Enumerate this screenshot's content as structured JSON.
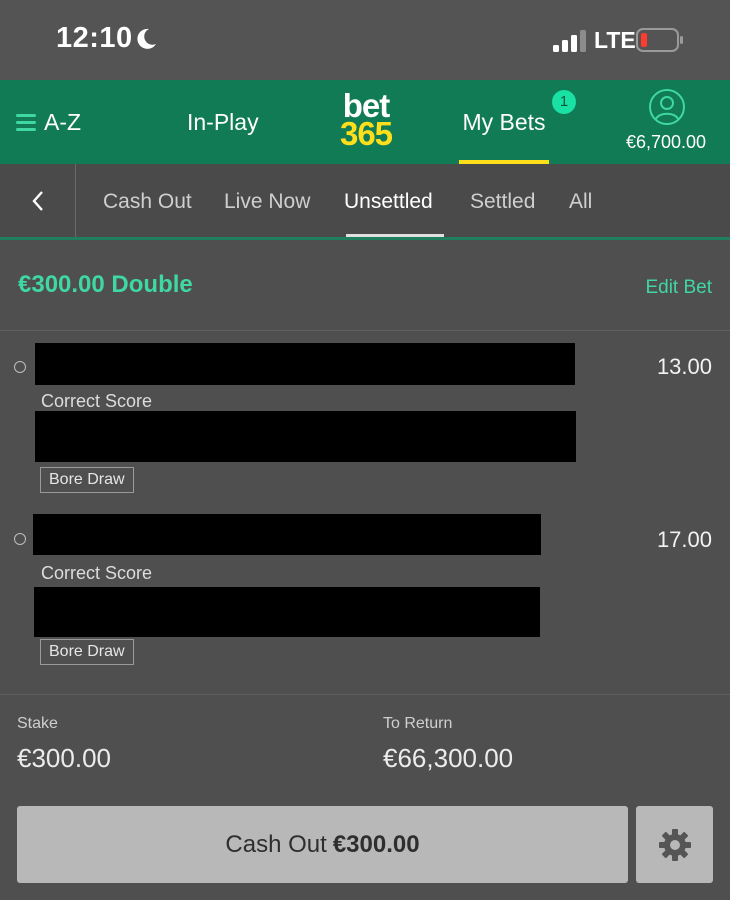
{
  "status_bar": {
    "time": "12:10",
    "network": "LTE"
  },
  "header": {
    "az_label": "A-Z",
    "inplay_label": "In-Play",
    "logo_top": "bet",
    "logo_bottom": "365",
    "mybets_label": "My Bets",
    "mybets_badge": "1",
    "balance": "€6,700.00",
    "brand_green": "#117b56",
    "brand_yellow": "#ffdf1b"
  },
  "tabs": {
    "items": [
      {
        "label": "Cash Out"
      },
      {
        "label": "Live Now"
      },
      {
        "label": "Unsettled"
      },
      {
        "label": "Settled"
      },
      {
        "label": "All"
      }
    ],
    "active": "Unsettled"
  },
  "bet": {
    "title": "€300.00 Double",
    "edit_label": "Edit Bet",
    "selections": [
      {
        "market": "Correct Score",
        "tag": "Bore Draw",
        "odds": "13.00"
      },
      {
        "market": "Correct Score",
        "tag": "Bore Draw",
        "odds": "17.00"
      }
    ],
    "stake_label": "Stake",
    "stake_value": "€300.00",
    "return_label": "To Return",
    "return_value": "€66,300.00"
  },
  "cashout": {
    "label": "Cash Out",
    "amount": "€300.00"
  }
}
